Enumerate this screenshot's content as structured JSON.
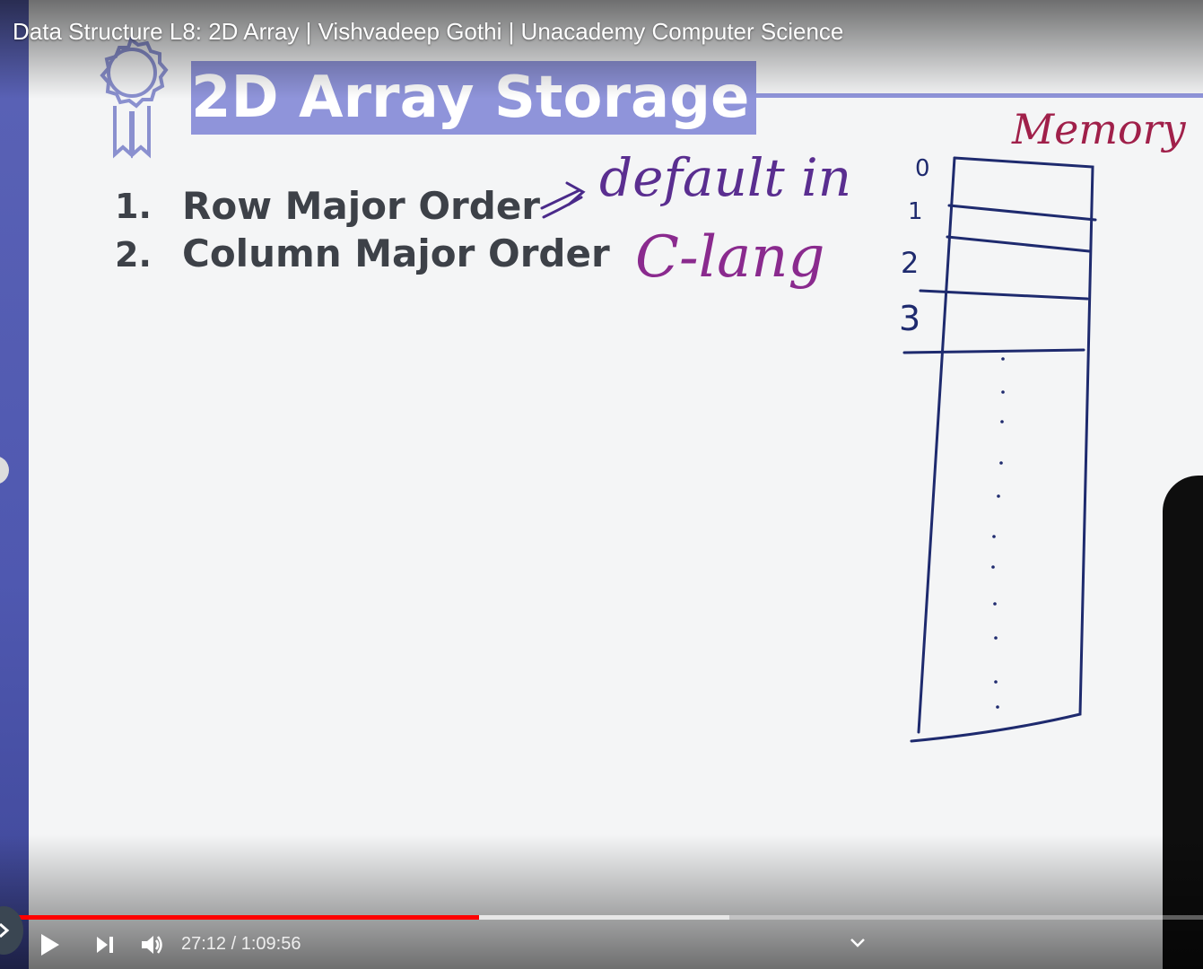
{
  "video": {
    "title": "Data Structure L8: 2D Array | Vishvadeep Gothi | Unacademy Computer Science"
  },
  "slide": {
    "title": "2D Array Storage",
    "items": [
      {
        "number": "1.",
        "label": "Row Major Order"
      },
      {
        "number": "2.",
        "label": "Column Major Order"
      }
    ]
  },
  "handwriting": {
    "note_line1": "default in",
    "note_line2": "C-lang",
    "memory_label": "Memory",
    "indices": [
      "0",
      "1",
      "2",
      "3"
    ]
  },
  "player": {
    "current_time": "27:12",
    "duration": "1:09:56",
    "time_text": "27:12 / 1:09:56",
    "progress_fraction": 0.3889,
    "buffered_fraction": 0.6,
    "accent_color": "#ff0000"
  },
  "icons": {
    "play": "play-icon",
    "next": "next-icon",
    "volume": "volume-icon",
    "chevron": "chevron-down-icon",
    "badge": "award-badge-icon"
  }
}
